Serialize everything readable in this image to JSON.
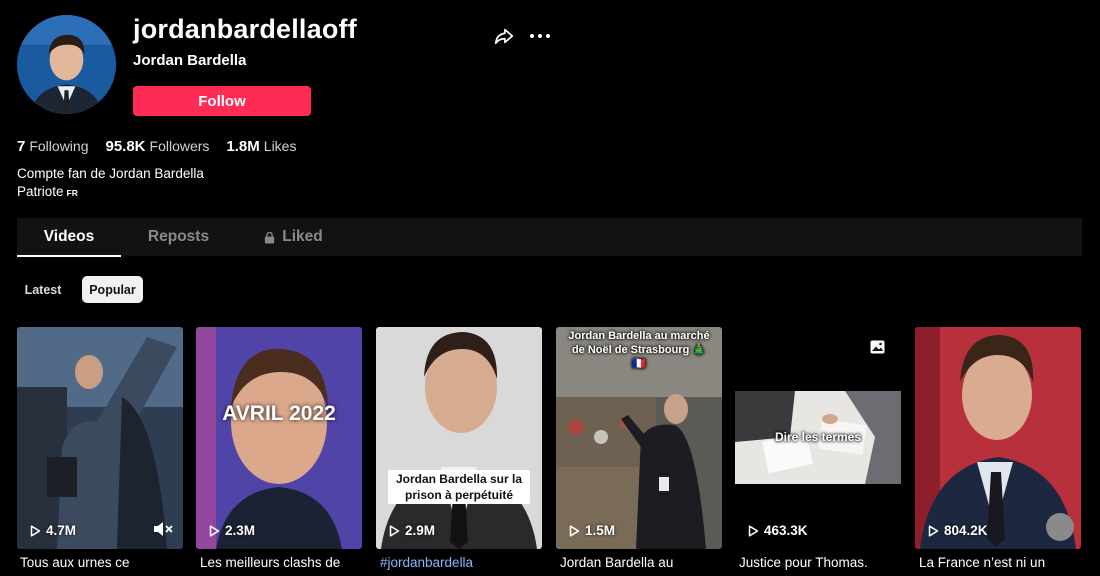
{
  "profile": {
    "username": "jordanbardellaoff",
    "nickname": "Jordan Bardella",
    "follow_label": "Follow",
    "bio_line1": "Compte fan de Jordan Bardella",
    "bio_line2": "Patriote",
    "bio_flag": "FR"
  },
  "stats": {
    "following_count": "7",
    "following_label": "Following",
    "followers_count": "95.8K",
    "followers_label": "Followers",
    "likes_count": "1.8M",
    "likes_label": "Likes"
  },
  "tabs": {
    "videos": "Videos",
    "reposts": "Reposts",
    "liked": "Liked"
  },
  "filters": {
    "latest": "Latest",
    "popular": "Popular"
  },
  "videos": [
    {
      "views": "4.7M",
      "title": "Tous aux urnes ce"
    },
    {
      "views": "2.3M",
      "title": "Les meilleurs clashs de",
      "overlay": "AVRIL 2022"
    },
    {
      "views": "2.9M",
      "title": "#jordanbardella",
      "caption": "Jordan Bardella sur la prison à perpétuité"
    },
    {
      "views": "1.5M",
      "title": "Jordan Bardella au",
      "caption": "Jordan Bardella au marché de Noël de Strasbourg 🎄🇫🇷"
    },
    {
      "views": "463.3K",
      "title": "Justice pour Thomas.",
      "caption": "Dire les termes"
    },
    {
      "views": "804.2K",
      "title": "La France n’est ni un"
    }
  ],
  "colors": {
    "accent": "#fe2c55",
    "background": "#000000",
    "tab_bar": "#121212"
  },
  "icons": [
    "share-icon",
    "more-icon",
    "lock-icon",
    "play-icon",
    "mute-icon",
    "photo-icon"
  ]
}
